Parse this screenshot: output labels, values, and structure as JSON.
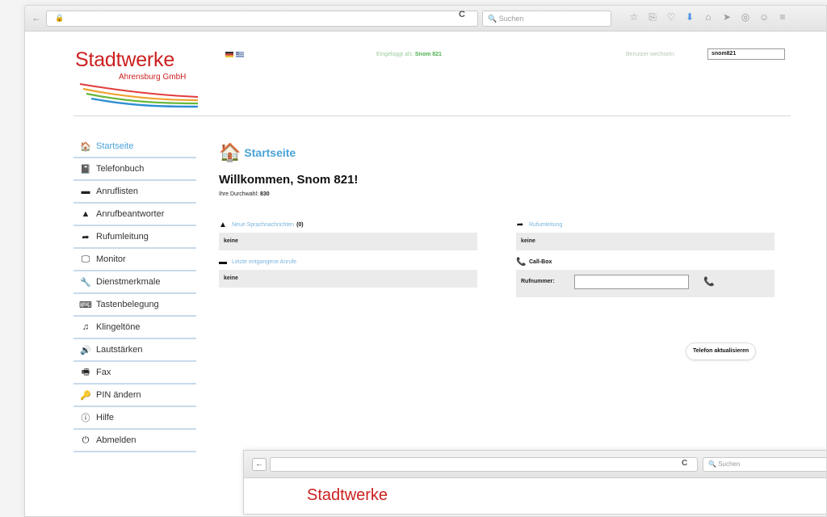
{
  "browser": {
    "search_placeholder": "Suchen",
    "reload_glyph": "C"
  },
  "header": {
    "logo_title": "Stadtwerke",
    "logo_subtitle": "Ahrensburg GmbH",
    "logged_in_label": "Eingeloggt als:",
    "logged_in_user": "Snom 821",
    "switch_user_label": "Benutzer wechseln:",
    "switch_user_value": "snom821"
  },
  "sidebar": {
    "items": [
      {
        "label": "Startseite",
        "icon": "home-icon",
        "glyph": "🏠",
        "active": true
      },
      {
        "label": "Telefonbuch",
        "icon": "book-icon",
        "glyph": "📓"
      },
      {
        "label": "Anruflisten",
        "icon": "list-icon",
        "glyph": "▬"
      },
      {
        "label": "Anrufbeantworter",
        "icon": "voicemail-icon",
        "glyph": "▲"
      },
      {
        "label": "Rufumleitung",
        "icon": "forward-arrow-icon",
        "glyph": "➦"
      },
      {
        "label": "Monitor",
        "icon": "monitor-icon",
        "glyph": "🖵"
      },
      {
        "label": "Dienstmerkmale",
        "icon": "wrench-icon",
        "glyph": "🔧"
      },
      {
        "label": "Tastenbelegung",
        "icon": "keyboard-icon",
        "glyph": "⌨"
      },
      {
        "label": "Klingeltöne",
        "icon": "music-icon",
        "glyph": "♫"
      },
      {
        "label": "Lautstärken",
        "icon": "volume-icon",
        "glyph": "🔊"
      },
      {
        "label": "Fax",
        "icon": "fax-icon",
        "glyph": "🖷"
      },
      {
        "label": "PIN ändern",
        "icon": "key-icon",
        "glyph": "🔑"
      },
      {
        "label": "Hilfe",
        "icon": "info-icon",
        "glyph": "ⓘ"
      },
      {
        "label": "Abmelden",
        "icon": "power-icon",
        "glyph": "⏻"
      }
    ]
  },
  "main": {
    "title": "Startseite",
    "welcome": "Willkommen, Snom 821!",
    "extension_label": "Ihre Durchwahl:",
    "extension_value": "830",
    "voicemail_header": "Neue Sprachnachrichten",
    "voicemail_count": "(0)",
    "voicemail_value": "keine",
    "missed_header": "Letzte entgangene Anrufe",
    "missed_value": "keine",
    "forward_header": "Rufumleitung",
    "forward_value": "keine",
    "callbox_header": "Call-Box",
    "number_label": "Rufnummer:",
    "update_button": "Telefon aktualisieren"
  },
  "nested": {
    "search_placeholder": "Suchen",
    "logo_partial": "Stadtwerke"
  }
}
